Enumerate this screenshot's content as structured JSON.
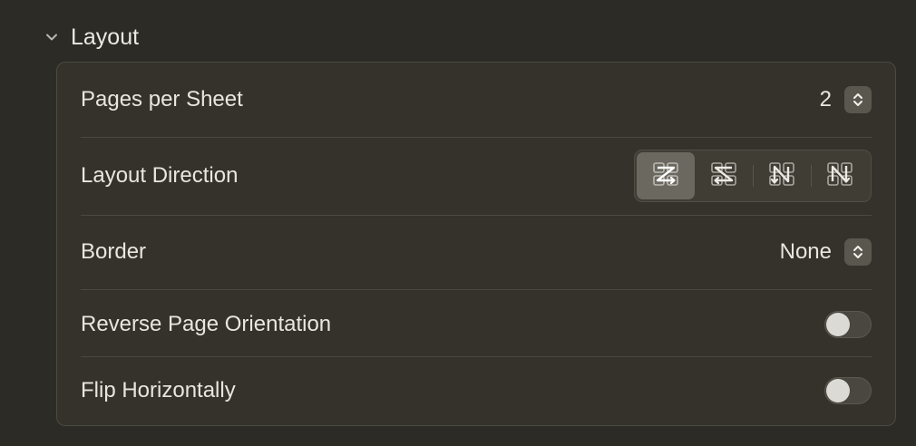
{
  "section": {
    "title": "Layout",
    "expanded": true,
    "chevron_icon": "chevron-down-icon"
  },
  "rows": {
    "pages_per_sheet": {
      "label": "Pages per Sheet",
      "value": "2",
      "icon": "up-down-stepper-icon"
    },
    "layout_direction": {
      "label": "Layout Direction",
      "options": [
        {
          "icon": "layout-z-left-right-icon",
          "selected": true
        },
        {
          "icon": "layout-reverse-z-right-left-icon",
          "selected": false
        },
        {
          "icon": "layout-n-reverse-top-bottom-icon",
          "selected": false
        },
        {
          "icon": "layout-n-top-bottom-icon",
          "selected": false
        }
      ]
    },
    "border": {
      "label": "Border",
      "value": "None",
      "icon": "up-down-stepper-icon"
    },
    "reverse_page_orientation": {
      "label": "Reverse Page Orientation",
      "enabled": false
    },
    "flip_horizontally": {
      "label": "Flip Horizontally",
      "enabled": false
    }
  },
  "colors": {
    "background": "#2d2b26",
    "panel": "#35322b",
    "text": "#e8e6e1",
    "selected_segment": "#6b6860"
  }
}
